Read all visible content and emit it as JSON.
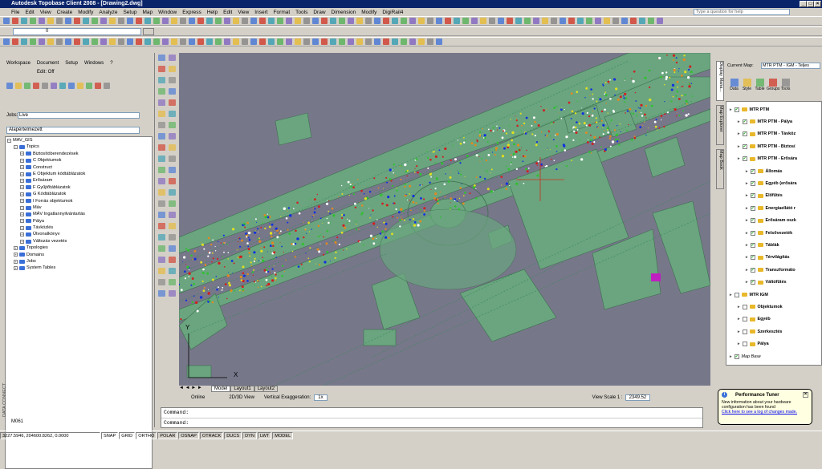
{
  "window": {
    "title": "Autodesk Topobase Client 2008 - [Drawing2.dwg]",
    "help_placeholder": "Type a question for help"
  },
  "menu": [
    "File",
    "Edit",
    "View",
    "Create",
    "Modify",
    "Analyze",
    "Setup",
    "Map",
    "Window",
    "Express",
    "Help",
    "Edit",
    "View",
    "Insert",
    "Format",
    "Tools",
    "Draw",
    "Dimension",
    "Modify",
    "DigiRail4"
  ],
  "layer_combo": {
    "value": "0"
  },
  "left_panel": {
    "menu": [
      "Workspace",
      "Document",
      "Setup",
      "Windows",
      "?"
    ],
    "edit_status": "Edit: Off",
    "jobs_label": "Jobs:",
    "jobs_value": "Live",
    "profile_value": "Alapértelmezett",
    "tree_root": "MAV_GIS",
    "topics_label": "Topics",
    "topics": [
      "Biztosítóberendezések",
      "C Objektumok",
      "Construct",
      "E Objektum kódtáblázatok",
      "Erősáram",
      "F Gyűjtőtáblázatok",
      "G Kódtáblázatok",
      "I Forrás objektumok",
      "Máv",
      "MÁV Ingatlannyilvántartás",
      "Pálya",
      "Távközlés",
      "Útvonalkönyv",
      "Változás vezetés"
    ],
    "other_nodes": [
      "Topologies",
      "Domains",
      "Jobs",
      "System Tables"
    ],
    "layout_label": "M061"
  },
  "side_label": "DATA CONNECT",
  "tabs": {
    "model": "Model",
    "layout1": "Layout1",
    "layout2": "Layout2"
  },
  "bottom_bar": {
    "online": "Online",
    "view": "2D/3D View",
    "vert_exag_label": "Vertical Exaggeration:",
    "vert_exag": "1x",
    "scale_label": "View Scale 1 :",
    "scale": "2349.52"
  },
  "command": {
    "line1": "Command:",
    "line2": "Command:"
  },
  "status": {
    "coords": "3227.5946, 204600.8262, 0.0000",
    "toggles": [
      "SNAP",
      "GRID",
      "ORTHO",
      "POLAR",
      "OSNAP",
      "OTRACK",
      "DUCS",
      "DYN",
      "LWT",
      "MODEL"
    ]
  },
  "right_panel": {
    "current_map_label": "Current Map:",
    "current_map": "MTR PTM - IGM - Teljes",
    "vtabs": [
      "Display Mana...",
      "Map Explorer",
      "Map Book"
    ],
    "toolbar": [
      "Data",
      "Style",
      "Table",
      "Groups",
      "Tools"
    ],
    "layers": [
      {
        "name": "MTR PTM",
        "level": 0,
        "checked": true
      },
      {
        "name": "MTR PTM - Pálya",
        "level": 1,
        "checked": true
      },
      {
        "name": "MTR PTM - Távköz",
        "level": 1,
        "checked": true
      },
      {
        "name": "MTR PTM - Biztosí",
        "level": 1,
        "checked": true
      },
      {
        "name": "MTR PTM - Erősára",
        "level": 1,
        "checked": true
      },
      {
        "name": "Állomás",
        "level": 2,
        "checked": true
      },
      {
        "name": "Egyéb (erősára",
        "level": 2,
        "checked": true
      },
      {
        "name": "Előfűtés",
        "level": 2,
        "checked": true
      },
      {
        "name": "Energiaellátó r",
        "level": 2,
        "checked": true
      },
      {
        "name": "Erősáram oszk",
        "level": 2,
        "checked": true
      },
      {
        "name": "Felsővezeték",
        "level": 2,
        "checked": true
      },
      {
        "name": "Táblák",
        "level": 2,
        "checked": true
      },
      {
        "name": "Térvilágítás",
        "level": 2,
        "checked": true
      },
      {
        "name": "Transzformáto",
        "level": 2,
        "checked": true
      },
      {
        "name": "Váltófűtés",
        "level": 2,
        "checked": true
      },
      {
        "name": "MTR IGM",
        "level": 0,
        "checked": false
      },
      {
        "name": "Objektumok",
        "level": 1,
        "checked": false
      },
      {
        "name": "Egyéb",
        "level": 1,
        "checked": false
      },
      {
        "name": "Szerkesztés",
        "level": 1,
        "checked": false
      },
      {
        "name": "Pálya",
        "level": 1,
        "checked": false
      },
      {
        "name": "Map Base",
        "level": 0,
        "checked": true
      }
    ]
  },
  "tooltip": {
    "title": "Performance Tuner",
    "body": "New information about your hardware configuration has been found",
    "link": "Click here to see a log of changes made."
  },
  "colors": {
    "titlebar": "#0a246a",
    "map_bg": "#77778a",
    "polygon": "#6aa57f",
    "highlight": "#c020c0"
  }
}
